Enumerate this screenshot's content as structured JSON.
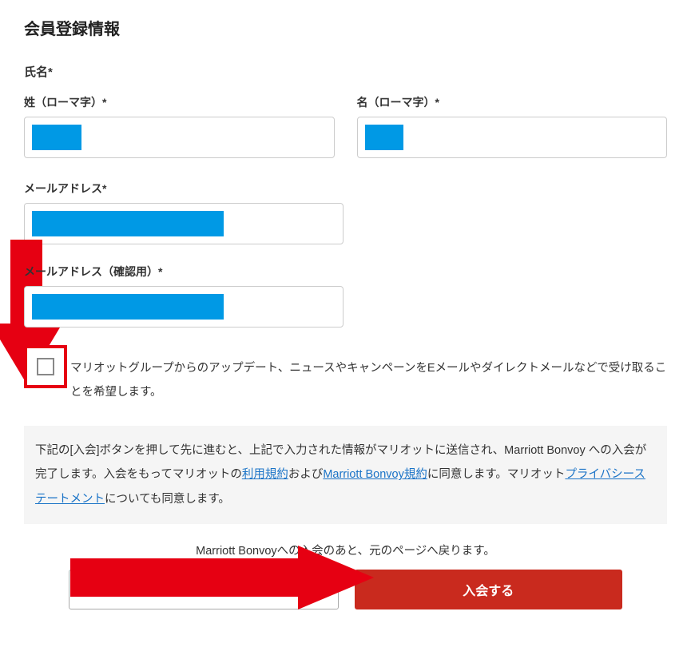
{
  "form": {
    "title": "会員登録情報",
    "nameSection": "氏名*",
    "lastNameLabel": "姓（ローマ字）*",
    "firstNameLabel": "名（ローマ字）*",
    "emailLabel": "メールアドレス*",
    "emailConfirmLabel": "メールアドレス（確認用）*",
    "checkboxLabel": "マリオットグループからのアップデート、ニュースやキャンペーンをEメールやダイレクトメールなどで受け取ることを希望します。"
  },
  "notice": {
    "part1": "下記の[入会]ボタンを押して先に進むと、上記で入力された情報がマリオットに送信され、Marriott Bonvoy への入会が完了します。入会をもってマリオットの",
    "link1": "利用規約",
    "part2": "および",
    "link2": "Marriott Bonvoy規約",
    "part3": "に同意します。マリオット",
    "link3": "プライバシーステートメント",
    "part4": "についても同意します。"
  },
  "footer": {
    "returnText": "Marriott Bonvoyへの入会のあと、元のページへ戻ります。",
    "submitLabel": "入会する"
  }
}
